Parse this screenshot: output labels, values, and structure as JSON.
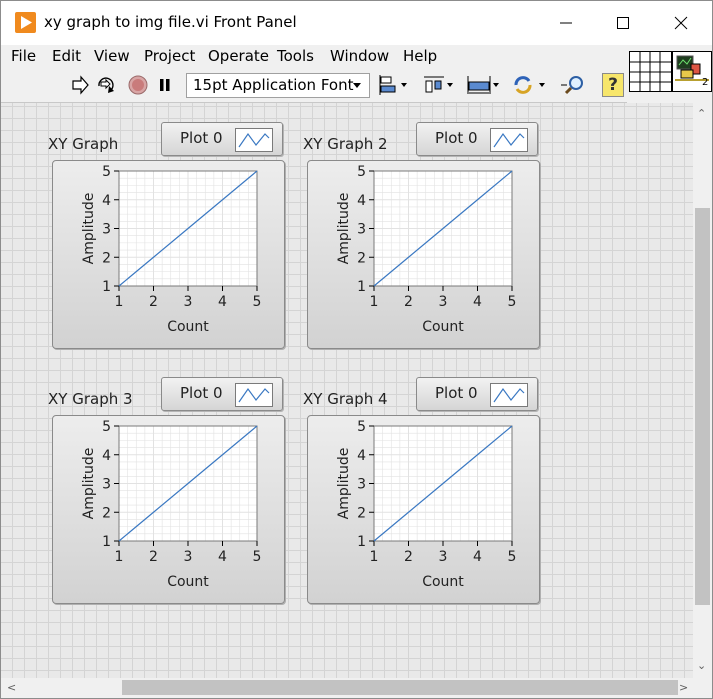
{
  "window": {
    "title": "xy graph to img file.vi Front Panel",
    "controls": {
      "minimize": "minimize-icon",
      "maximize": "maximize-icon",
      "close": "close-icon"
    }
  },
  "menubar": {
    "items": [
      {
        "label": "File"
      },
      {
        "label": "Edit"
      },
      {
        "label": "View"
      },
      {
        "label": "Project"
      },
      {
        "label": "Operate"
      },
      {
        "label": "Tools"
      },
      {
        "label": "Window"
      },
      {
        "label": "Help"
      }
    ]
  },
  "toolbar": {
    "font": "15pt Application Font",
    "help": "?",
    "icons": [
      "run-arrow-icon",
      "run-continuous-icon",
      "abort-icon",
      "pause-icon",
      "align-objects-icon",
      "distribute-objects-icon",
      "resize-objects-icon",
      "reorder-icon",
      "search-icon",
      "context-help-icon"
    ]
  },
  "connector": {
    "vi_icon_number": "2"
  },
  "colors": {
    "plot_line": "#3a78c2",
    "grid": "#e2e2e2",
    "panel_grid": "#d4d4d4",
    "app_icon": "#f08a1e"
  },
  "graphs": [
    {
      "label": "XY Graph",
      "legend": "Plot 0",
      "xlabel": "Count",
      "ylabel": "Amplitude"
    },
    {
      "label": "XY Graph 2",
      "legend": "Plot 0",
      "xlabel": "Count",
      "ylabel": "Amplitude"
    },
    {
      "label": "XY Graph 3",
      "legend": "Plot 0",
      "xlabel": "Count",
      "ylabel": "Amplitude"
    },
    {
      "label": "XY Graph 4",
      "legend": "Plot 0",
      "xlabel": "Count",
      "ylabel": "Amplitude"
    }
  ],
  "chart_data": [
    {
      "type": "line",
      "title": "XY Graph",
      "xlabel": "Count",
      "ylabel": "Amplitude",
      "xlim": [
        1,
        5
      ],
      "ylim": [
        1,
        5
      ],
      "xticks": [
        1,
        2,
        3,
        4,
        5
      ],
      "yticks": [
        1,
        2,
        3,
        4,
        5
      ],
      "grid": true,
      "legend": "top-right",
      "series": [
        {
          "name": "Plot 0",
          "x": [
            1,
            2,
            3,
            4,
            5
          ],
          "y": [
            1,
            2,
            3,
            4,
            5
          ]
        }
      ]
    },
    {
      "type": "line",
      "title": "XY Graph 2",
      "xlabel": "Count",
      "ylabel": "Amplitude",
      "xlim": [
        1,
        5
      ],
      "ylim": [
        1,
        5
      ],
      "xticks": [
        1,
        2,
        3,
        4,
        5
      ],
      "yticks": [
        1,
        2,
        3,
        4,
        5
      ],
      "grid": true,
      "legend": "top-right",
      "series": [
        {
          "name": "Plot 0",
          "x": [
            1,
            2,
            3,
            4,
            5
          ],
          "y": [
            1,
            2,
            3,
            4,
            5
          ]
        }
      ]
    },
    {
      "type": "line",
      "title": "XY Graph 3",
      "xlabel": "Count",
      "ylabel": "Amplitude",
      "xlim": [
        1,
        5
      ],
      "ylim": [
        1,
        5
      ],
      "xticks": [
        1,
        2,
        3,
        4,
        5
      ],
      "yticks": [
        1,
        2,
        3,
        4,
        5
      ],
      "grid": true,
      "legend": "top-right",
      "series": [
        {
          "name": "Plot 0",
          "x": [
            1,
            2,
            3,
            4,
            5
          ],
          "y": [
            1,
            2,
            3,
            4,
            5
          ]
        }
      ]
    },
    {
      "type": "line",
      "title": "XY Graph 4",
      "xlabel": "Count",
      "ylabel": "Amplitude",
      "xlim": [
        1,
        5
      ],
      "ylim": [
        1,
        5
      ],
      "xticks": [
        1,
        2,
        3,
        4,
        5
      ],
      "yticks": [
        1,
        2,
        3,
        4,
        5
      ],
      "grid": true,
      "legend": "top-right",
      "series": [
        {
          "name": "Plot 0",
          "x": [
            1,
            2,
            3,
            4,
            5
          ],
          "y": [
            1,
            2,
            3,
            4,
            5
          ]
        }
      ]
    }
  ]
}
